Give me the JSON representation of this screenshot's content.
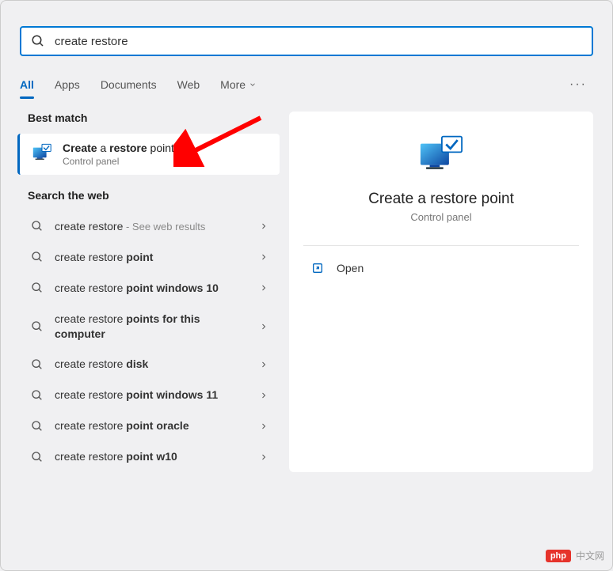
{
  "search": {
    "value": "create restore "
  },
  "tabs": [
    "All",
    "Apps",
    "Documents",
    "Web",
    "More"
  ],
  "active_tab_index": 0,
  "sections": {
    "best_match": "Best match",
    "web": "Search the web"
  },
  "best_match": {
    "title_parts": [
      "Create",
      " a ",
      "restore",
      " point"
    ],
    "subtitle": "Control panel"
  },
  "web_results": [
    {
      "prefix": "create restore",
      "bold": "",
      "hint": " - See web results"
    },
    {
      "prefix": "create restore ",
      "bold": "point",
      "hint": ""
    },
    {
      "prefix": "create restore ",
      "bold": "point windows 10",
      "hint": ""
    },
    {
      "prefix": "create restore ",
      "bold": "points for this computer",
      "hint": ""
    },
    {
      "prefix": "create restore ",
      "bold": "disk",
      "hint": ""
    },
    {
      "prefix": "create restore ",
      "bold": "point windows 11",
      "hint": ""
    },
    {
      "prefix": "create restore ",
      "bold": "point oracle",
      "hint": ""
    },
    {
      "prefix": "create restore ",
      "bold": "point w10",
      "hint": ""
    }
  ],
  "preview": {
    "title": "Create a restore point",
    "subtitle": "Control panel",
    "actions": {
      "open": "Open"
    }
  },
  "watermark": {
    "badge": "php",
    "text": "中文网"
  },
  "colors": {
    "accent": "#0067c0",
    "arrow": "#ff0000"
  }
}
